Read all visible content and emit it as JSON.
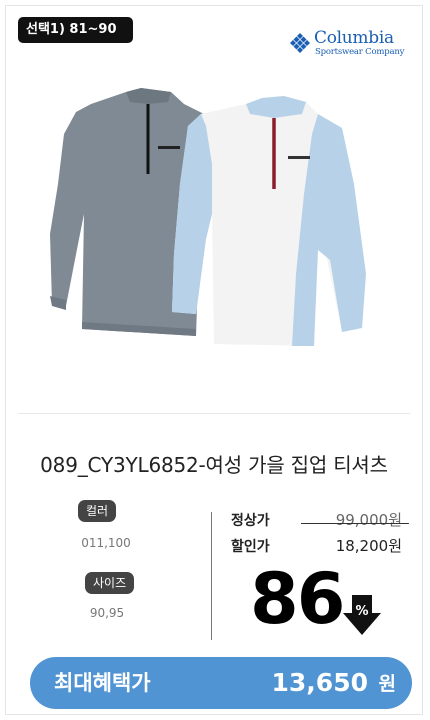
{
  "option_badge": "선택1) 81~90",
  "brand": {
    "name": "Columbia",
    "subtitle": "Sportswear Company",
    "color": "#1a5fb4",
    "icon": "columbia-diamond-logo"
  },
  "product": {
    "name": "089_CY3YL6852-여성 가을 집업 티셔츠",
    "image_alt": "gray and light blue half-zip long sleeve tees"
  },
  "options": {
    "color_label": "컬러",
    "color_value": "011,100",
    "size_label": "사이즈",
    "size_value": "90,95"
  },
  "pricing": {
    "regular_label": "정상가",
    "regular_price": "99,000원",
    "sale_label": "할인가",
    "sale_price": "18,200원",
    "discount_rate": "86",
    "discount_unit": "%",
    "discount_icon": "down-arrow-icon"
  },
  "benefit": {
    "label": "최대혜택가",
    "price": "13,650",
    "unit": "원",
    "color": "#5094d3"
  }
}
